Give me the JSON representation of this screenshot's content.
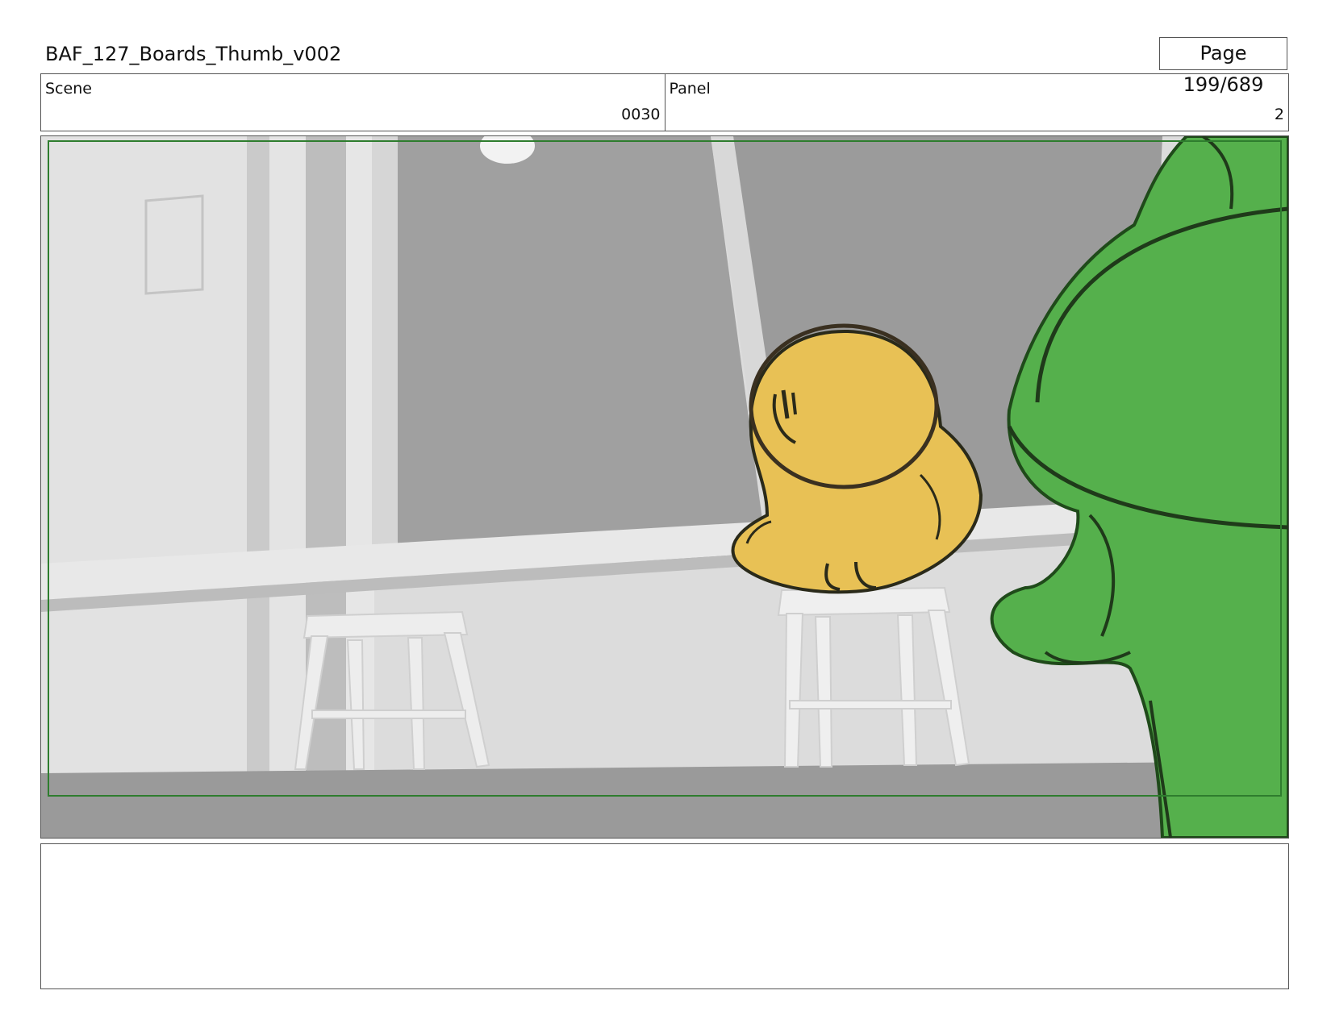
{
  "header": {
    "title": "BAF_127_Boards_Thumb_v002",
    "page": "Page 199/689"
  },
  "info": {
    "scene_label": "Scene",
    "scene_value": "0030",
    "panel_label": "Panel",
    "panel_value": "2"
  },
  "panel_image": {
    "subjects": [
      "yellow-character",
      "green-character",
      "stool",
      "window",
      "wall"
    ],
    "colors": {
      "safe_frame": "#2e7d2e",
      "yellow_character": "#e8c155",
      "green_character": "#55b04c",
      "window_glass": "#9e9e9e",
      "wall": "#dcdcdc"
    }
  },
  "notes": {
    "text": ""
  }
}
